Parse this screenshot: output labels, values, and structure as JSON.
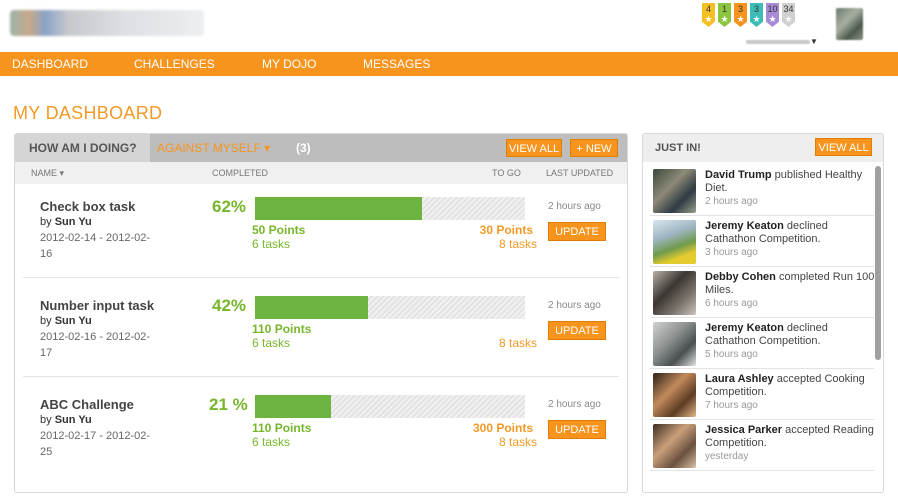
{
  "nav": {
    "items": [
      "DASHBOARD",
      "CHALLENGES",
      "MY DOJO",
      "MESSAGES"
    ]
  },
  "badges": [
    {
      "count": "4",
      "color": "#f4c024"
    },
    {
      "count": "1",
      "color": "#8cc63e"
    },
    {
      "count": "3",
      "color": "#f7941d"
    },
    {
      "count": "3",
      "color": "#3dbcb7"
    },
    {
      "count": "10",
      "color": "#a78bd6"
    },
    {
      "count": "34",
      "color": "#d0d0d0"
    }
  ],
  "page": {
    "title": "MY DASHBOARD"
  },
  "main": {
    "tab_active": "HOW AM I DOING?",
    "tab_filter": "AGAINST MYSELF ▾",
    "count": "(3)",
    "view_all": "VIEW ALL",
    "new": "+ NEW",
    "columns": {
      "name": "NAME ▾",
      "completed": "COMPLETED",
      "to_go": "TO GO",
      "last_updated": "LAST UPDATED"
    },
    "update_label": "UPDATE",
    "rows": [
      {
        "name": "Check box task",
        "by_label": "by",
        "author": "Sun Yu",
        "dates": "2012-02-14 - 2012-02-16",
        "pct_text": "62%",
        "progress": 0.62,
        "done_points": "50 Points",
        "done_tasks": "6 tasks",
        "togo_points": "30 Points",
        "togo_tasks": "8 tasks",
        "updated": "2 hours ago"
      },
      {
        "name": "Number input task",
        "by_label": "by",
        "author": "Sun Yu",
        "dates": "2012-02-16 - 2012-02-17",
        "pct_text": "42%",
        "progress": 0.42,
        "done_points": "110 Points",
        "done_tasks": "6 tasks",
        "togo_points": "",
        "togo_tasks": "8 tasks",
        "updated": "2 hours ago"
      },
      {
        "name": "ABC Challenge",
        "by_label": "by",
        "author": "Sun Yu",
        "dates": "2012-02-17 - 2012-02-25",
        "pct_text": "21 %",
        "progress": 0.28,
        "done_points": "110 Points",
        "done_tasks": "6 tasks",
        "togo_points": "300 Points",
        "togo_tasks": "8 tasks",
        "updated": "2 hours ago"
      }
    ]
  },
  "feed": {
    "title": "JUST IN!",
    "view_all": "VIEW ALL",
    "items": [
      {
        "name": "David Trump",
        "action": " published Healthy Diet.",
        "time": "2 hours ago",
        "thumb": "linear-gradient(135deg,#3a4a3c,#8d8a78 40%,#2f3a44 70%,#9aa08a)"
      },
      {
        "name": "Jeremy Keaton",
        "action": " declined Cathathon Competition.",
        "time": "3 hours ago",
        "thumb": "linear-gradient(160deg,#d9e6ee,#9fb5c2 35%,#6f9a4d 60%,#e5cc2e 80%)"
      },
      {
        "name": "Debby Cohen",
        "action": " completed Run 100 Miles.",
        "time": "6 hours ago",
        "thumb": "linear-gradient(135deg,#b8b0a6,#3b3633 40%,#7c746c 70%,#cbc5bd)"
      },
      {
        "name": "Jeremy Keaton",
        "action": " declined Cathathon Competition.",
        "time": "5 hours ago",
        "thumb": "linear-gradient(135deg,#cfd2d0,#8e9391 40%,#4a4f52 70%,#e0e3e2)"
      },
      {
        "name": "Laura Ashley",
        "action": " accepted Cooking Competition.",
        "time": "7 hours ago",
        "thumb": "linear-gradient(135deg,#2c2118,#c28a5b 40%,#5e3d24 70%,#e3b58a)"
      },
      {
        "name": "Jessica Parker",
        "action": " accepted Reading Competition.",
        "time": "yesterday",
        "thumb": "linear-gradient(135deg,#3e2e22,#caa07a 40%,#6a5040 70%,#d9c1a5)"
      }
    ]
  }
}
